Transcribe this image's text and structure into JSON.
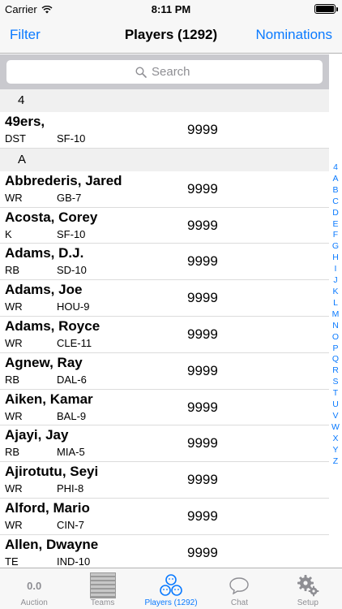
{
  "status": {
    "carrier": "Carrier",
    "time": "8:11 PM"
  },
  "nav": {
    "left": "Filter",
    "title": "Players (1292)",
    "right": "Nominations"
  },
  "search": {
    "placeholder": "Search"
  },
  "sections": [
    {
      "header": "4",
      "rows": [
        {
          "name": "49ers,",
          "pos": "DST",
          "team": "SF-10",
          "value": "9999"
        }
      ]
    },
    {
      "header": "A",
      "rows": [
        {
          "name": "Abbrederis, Jared",
          "pos": "WR",
          "team": "GB-7",
          "value": "9999"
        },
        {
          "name": "Acosta, Corey",
          "pos": "K",
          "team": "SF-10",
          "value": "9999"
        },
        {
          "name": "Adams, D.J.",
          "pos": "RB",
          "team": "SD-10",
          "value": "9999"
        },
        {
          "name": "Adams, Joe",
          "pos": "WR",
          "team": "HOU-9",
          "value": "9999"
        },
        {
          "name": "Adams, Royce",
          "pos": "WR",
          "team": "CLE-11",
          "value": "9999"
        },
        {
          "name": "Agnew, Ray",
          "pos": "RB",
          "team": "DAL-6",
          "value": "9999"
        },
        {
          "name": "Aiken, Kamar",
          "pos": "WR",
          "team": "BAL-9",
          "value": "9999"
        },
        {
          "name": "Ajayi, Jay",
          "pos": "RB",
          "team": "MIA-5",
          "value": "9999"
        },
        {
          "name": "Ajirotutu, Seyi",
          "pos": "WR",
          "team": "PHI-8",
          "value": "9999"
        },
        {
          "name": "Alford, Mario",
          "pos": "WR",
          "team": "CIN-7",
          "value": "9999"
        },
        {
          "name": "Allen, Dwayne",
          "pos": "TE",
          "team": "IND-10",
          "value": "9999"
        }
      ]
    }
  ],
  "index": [
    "4",
    "A",
    "B",
    "C",
    "D",
    "E",
    "F",
    "G",
    "H",
    "I",
    "J",
    "K",
    "L",
    "M",
    "N",
    "O",
    "P",
    "Q",
    "R",
    "S",
    "T",
    "U",
    "V",
    "W",
    "X",
    "Y",
    "Z"
  ],
  "tabs": [
    {
      "id": "auction",
      "label": "Auction",
      "display": "0.0",
      "icon": "auction-value"
    },
    {
      "id": "teams",
      "label": "Teams",
      "icon": "teams-board-icon"
    },
    {
      "id": "players",
      "label": "Players (1292)",
      "icon": "players-group-icon",
      "active": true
    },
    {
      "id": "chat",
      "label": "Chat",
      "icon": "chat-bubble-icon"
    },
    {
      "id": "setup",
      "label": "Setup",
      "icon": "gears-icon"
    }
  ],
  "colors": {
    "accent": "#0a7aff",
    "inactive": "#8e8e93"
  }
}
